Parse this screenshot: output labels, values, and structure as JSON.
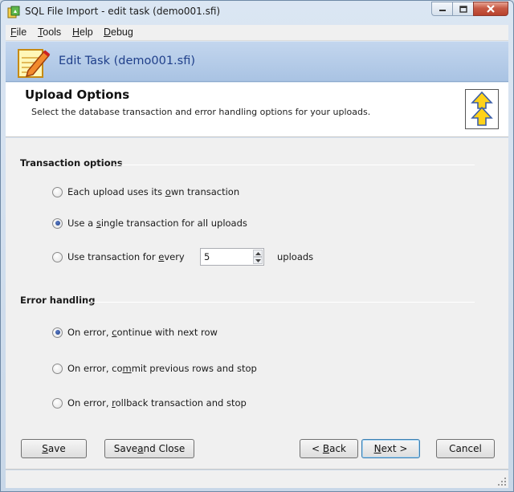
{
  "window": {
    "title": "SQL File Import - edit task (demo001.sfi)"
  },
  "menu": {
    "items": [
      {
        "label": "File",
        "accel": "F",
        "rest": "ile"
      },
      {
        "label": "Tools",
        "accel": "T",
        "rest": "ools"
      },
      {
        "label": "Help",
        "accel": "H",
        "rest": "elp"
      },
      {
        "label": "Debug",
        "accel": "D",
        "rest": "ebug"
      }
    ]
  },
  "banner": {
    "title": "Edit Task (demo001.sfi)",
    "icon": "notepad-pencil-icon"
  },
  "header": {
    "title": "Upload Options",
    "subtitle": "Select the database transaction and error handling options for your uploads.",
    "icon": "upload-arrows-icon"
  },
  "transaction": {
    "group_label": "Transaction options",
    "opt1": {
      "pre": "Each upload uses its ",
      "accel": "o",
      "post": "wn transaction",
      "checked": false
    },
    "opt2": {
      "pre": "Use a ",
      "accel": "s",
      "post": "ingle transaction for all uploads",
      "checked": true
    },
    "opt3": {
      "pre": "Use transaction for ",
      "accel": "e",
      "post": "very",
      "checked": false
    },
    "every_value": "5",
    "uploads_label": "uploads"
  },
  "errors": {
    "group_label": "Error handling",
    "opt1": {
      "pre": "On error, ",
      "accel": "c",
      "post": "ontinue with next row",
      "checked": true
    },
    "opt2": {
      "pre": "On error, co",
      "accel": "m",
      "post": "mit previous rows and stop",
      "checked": false
    },
    "opt3": {
      "pre": "On error, ",
      "accel": "r",
      "post": "ollback transaction and stop",
      "checked": false
    }
  },
  "buttons": {
    "save": {
      "accel": "S",
      "rest": "ave"
    },
    "save_close": {
      "pre": "Save ",
      "accel": "a",
      "post": "nd Close"
    },
    "back": {
      "pre": "< ",
      "accel": "B",
      "post": "ack"
    },
    "next": {
      "accel": "N",
      "post": "ext >"
    },
    "cancel": {
      "label": "Cancel"
    }
  },
  "colors": {
    "accent": "#1f3f8a",
    "banner": "#b7cdea"
  }
}
